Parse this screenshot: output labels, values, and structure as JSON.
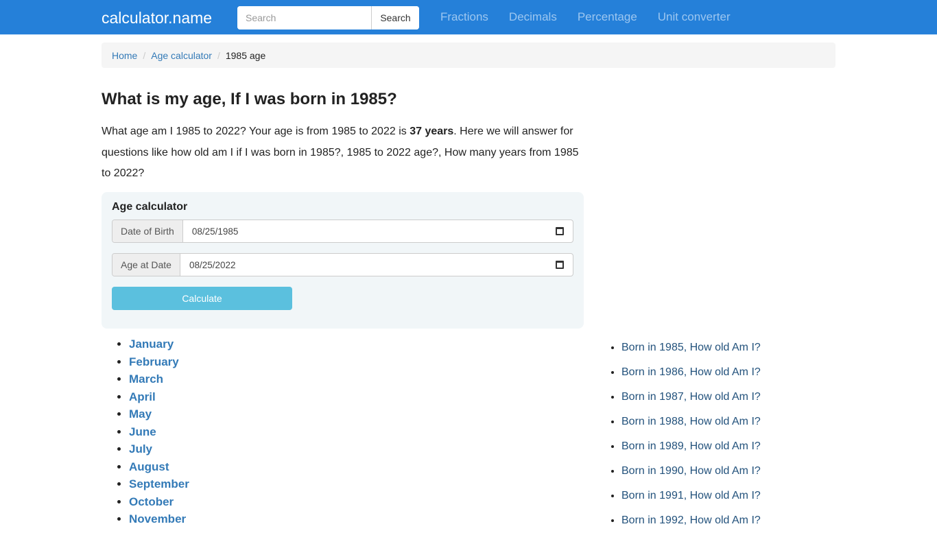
{
  "header": {
    "brand": "calculator.name",
    "search_placeholder": "Search",
    "search_button": "Search",
    "nav": [
      "Fractions",
      "Decimals",
      "Percentage",
      "Unit converter"
    ]
  },
  "breadcrumb": {
    "items": [
      "Home",
      "Age calculator"
    ],
    "separator": "/",
    "current": "1985 age"
  },
  "main": {
    "title": "What is my age, If I was born in 1985?",
    "intro_before": "What age am I 1985 to 2022? Your age is from 1985 to 2022 is ",
    "intro_bold": "37 years",
    "intro_after": ". Here we will answer for questions like how old am I if I was born in 1985?, 1985 to 2022 age?, How many years from 1985 to 2022?"
  },
  "calculator": {
    "title": "Age calculator",
    "dob_label": "Date of Birth",
    "dob_value": "08/25/1985",
    "date_label": "Age at Date",
    "date_value": "08/25/2022",
    "button": "Calculate",
    "icon": "calendar-icon"
  },
  "months": [
    "January",
    "February",
    "March",
    "April",
    "May",
    "June",
    "July",
    "August",
    "September",
    "October",
    "November"
  ],
  "years": [
    "Born in 1985, How old Am I?",
    "Born in 1986, How old Am I?",
    "Born in 1987, How old Am I?",
    "Born in 1988, How old Am I?",
    "Born in 1989, How old Am I?",
    "Born in 1990, How old Am I?",
    "Born in 1991, How old Am I?",
    "Born in 1992, How old Am I?"
  ]
}
